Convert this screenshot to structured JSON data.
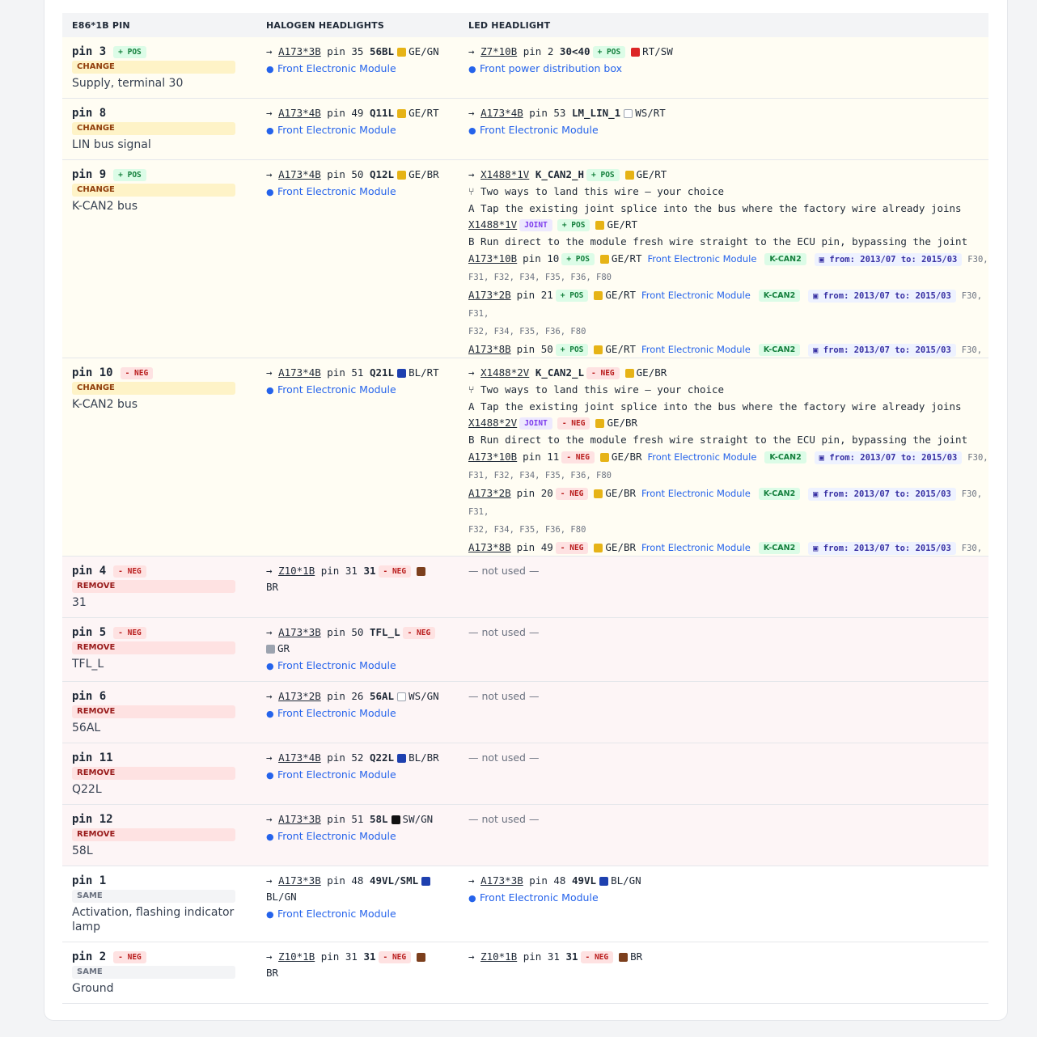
{
  "headers": {
    "col1": "E86*1B PIN",
    "col2": "HALOGEN HEADLIGHTS",
    "col3": "LED HEADLIGHT"
  },
  "not_used": "— not used —",
  "common": {
    "fem": "Front Electronic Module",
    "fpdb": "Front power distribution box",
    "two_ways": "Two ways to land this wire — your choice",
    "opt_a": "A Tap the existing joint splice into the bus where the factory wire already joins",
    "opt_b": "B Run direct to the module fresh wire straight to the ECU pin, bypassing the joint",
    "kcan": "K-CAN2",
    "date": "from: 2013/07 to: 2015/03",
    "models_a": "F30,",
    "models_b": "F31, F32, F34, F35, F36, F80",
    "models_c": "F30, F31,",
    "models_d": "F32, F34, F35, F36, F80",
    "pin_word": "pin",
    "arrow": "→"
  },
  "badges": {
    "pos": "+ POS",
    "neg": "- NEG",
    "joint": "JOINT"
  },
  "status": {
    "change": "CHANGE",
    "remove": "REMOVE",
    "same": "SAME"
  },
  "colors": {
    "GE": "#e6b316",
    "RT": "#dc2626",
    "WS": "#ffffff",
    "BL": "#1e40af",
    "BR": "#7c3f1d",
    "GR": "#9ca3af",
    "SW": "#111111"
  },
  "rows": [
    {
      "pin": "pin 3",
      "desc": "Supply, terminal 30",
      "hal": {
        "conn": "A173*3B",
        "pin": "pin 35",
        "sig": "56BL",
        "color": "GE/GN"
      },
      "led": {
        "conn": "Z7*10B",
        "pin": "pin 2",
        "sig": "30<40",
        "color": "RT/SW"
      }
    },
    {
      "pin": "pin 8",
      "desc": "LIN bus signal",
      "hal": {
        "conn": "A173*4B",
        "pin": "pin 49",
        "sig": "Q11L",
        "color": "GE/RT"
      },
      "led": {
        "conn": "A173*4B",
        "pin": "pin 53",
        "sig": "LM_LIN_1",
        "color": "WS/RT"
      }
    },
    {
      "pin": "pin 9",
      "desc": "K-CAN2 bus",
      "hal": {
        "conn": "A173*4B",
        "pin": "pin 50",
        "sig": "Q12L",
        "color": "GE/BR"
      },
      "led": {
        "conn": "X1488*1V",
        "sig": "K_CAN2_H",
        "color": "GE/RT",
        "joint": {
          "conn": "X1488*1V",
          "color": "GE/RT"
        },
        "direct": [
          {
            "conn": "A173*10B",
            "pin": "pin 10",
            "color": "GE/RT"
          },
          {
            "conn": "A173*2B",
            "pin": "pin 21",
            "color": "GE/RT"
          },
          {
            "conn": "A173*8B",
            "pin": "pin 50",
            "color": "GE/RT"
          }
        ]
      }
    },
    {
      "pin": "pin 10",
      "desc": "K-CAN2 bus",
      "hal": {
        "conn": "A173*4B",
        "pin": "pin 51",
        "sig": "Q21L",
        "color": "BL/RT"
      },
      "led": {
        "conn": "X1488*2V",
        "sig": "K_CAN2_L",
        "color": "GE/BR",
        "joint": {
          "conn": "X1488*2V",
          "color": "GE/BR"
        },
        "direct": [
          {
            "conn": "A173*10B",
            "pin": "pin 11",
            "color": "GE/BR"
          },
          {
            "conn": "A173*2B",
            "pin": "pin 20",
            "color": "GE/BR"
          },
          {
            "conn": "A173*8B",
            "pin": "pin 49",
            "color": "GE/BR"
          }
        ]
      }
    },
    {
      "pin": "pin 4",
      "desc": "31",
      "hal": {
        "conn": "Z10*1B",
        "pin": "pin 31",
        "sig": "31",
        "color": "BR"
      }
    },
    {
      "pin": "pin 5",
      "desc": "TFL_L",
      "hal": {
        "conn": "A173*3B",
        "pin": "pin 50",
        "sig": "TFL_L",
        "color": "GR"
      }
    },
    {
      "pin": "pin 6",
      "desc": "56AL",
      "hal": {
        "conn": "A173*2B",
        "pin": "pin 26",
        "sig": "56AL",
        "color": "WS/GN"
      }
    },
    {
      "pin": "pin 11",
      "desc": "Q22L",
      "hal": {
        "conn": "A173*4B",
        "pin": "pin 52",
        "sig": "Q22L",
        "color": "BL/BR"
      }
    },
    {
      "pin": "pin 12",
      "desc": "58L",
      "hal": {
        "conn": "A173*3B",
        "pin": "pin 51",
        "sig": "58L",
        "color": "SW/GN"
      }
    },
    {
      "pin": "pin 1",
      "desc": "Activation, flashing indicator lamp",
      "hal": {
        "conn": "A173*3B",
        "pin": "pin 48",
        "sig": "49VL/SML",
        "color": "BL/GN"
      },
      "led": {
        "conn": "A173*3B",
        "pin": "pin 48",
        "sig": "49VL",
        "color": "BL/GN"
      }
    },
    {
      "pin": "pin 2",
      "desc": "Ground",
      "hal": {
        "conn": "Z10*1B",
        "pin": "pin 31",
        "sig": "31",
        "color": "BR"
      },
      "led": {
        "conn": "Z10*1B",
        "pin": "pin 31",
        "sig": "31",
        "color": "BR"
      }
    }
  ]
}
